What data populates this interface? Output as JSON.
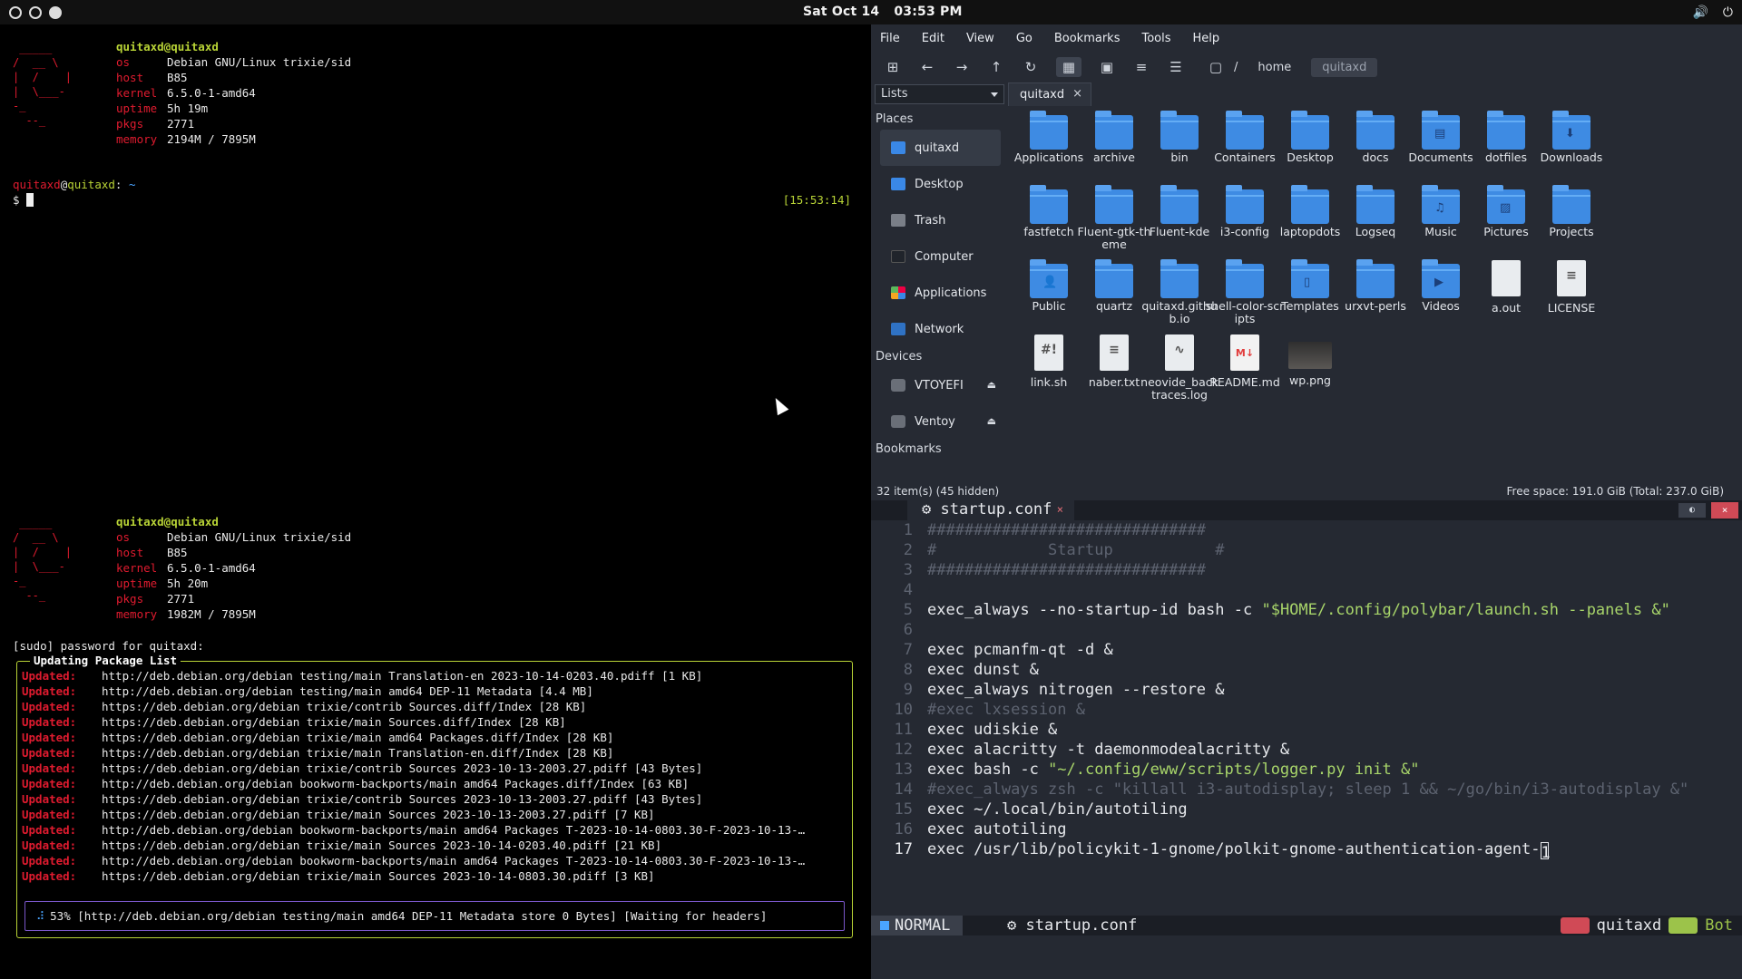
{
  "topbar": {
    "date": "Sat Oct 14",
    "time": "03:53 PM",
    "volume_icon": "volume-icon",
    "power_icon": "power-icon"
  },
  "term1": {
    "fetch": {
      "userhost": "quitaxd@quitaxd",
      "rows": [
        {
          "k": "os",
          "v": "Debian GNU/Linux trixie/sid"
        },
        {
          "k": "host",
          "v": "B85"
        },
        {
          "k": "kernel",
          "v": "6.5.0-1-amd64"
        },
        {
          "k": "uptime",
          "v": "5h 19m"
        },
        {
          "k": "pkgs",
          "v": "2771"
        },
        {
          "k": "memory",
          "v": "2194M / 7895M"
        }
      ]
    },
    "prompt": {
      "user": "quitaxd",
      "host": "quitaxd",
      "dir": "~",
      "time": "[15:53:14]",
      "symbol": "$"
    }
  },
  "term2": {
    "fetch": {
      "userhost": "quitaxd@quitaxd",
      "rows": [
        {
          "k": "os",
          "v": "Debian GNU/Linux trixie/sid"
        },
        {
          "k": "host",
          "v": "B85"
        },
        {
          "k": "kernel",
          "v": "6.5.0-1-amd64"
        },
        {
          "k": "uptime",
          "v": "5h 20m"
        },
        {
          "k": "pkgs",
          "v": "2771"
        },
        {
          "k": "memory",
          "v": "1982M / 7895M"
        }
      ]
    },
    "sudo_prompt": "[sudo] password for quitaxd:",
    "update_title": "Updating Package List",
    "update_label": "Updated:",
    "updates": [
      "http://deb.debian.org/debian testing/main Translation-en 2023-10-14-0203.40.pdiff [1 KB]",
      "http://deb.debian.org/debian testing/main amd64 DEP-11 Metadata [4.4 MB]",
      "https://deb.debian.org/debian trixie/contrib Sources.diff/Index [28 KB]",
      "https://deb.debian.org/debian trixie/main Sources.diff/Index [28 KB]",
      "https://deb.debian.org/debian trixie/main amd64 Packages.diff/Index [28 KB]",
      "https://deb.debian.org/debian trixie/main Translation-en.diff/Index [28 KB]",
      "https://deb.debian.org/debian trixie/contrib Sources 2023-10-13-2003.27.pdiff [43 Bytes]",
      "http://deb.debian.org/debian bookworm-backports/main amd64 Packages.diff/Index [63 KB]",
      "https://deb.debian.org/debian trixie/contrib Sources 2023-10-13-2003.27.pdiff [43 Bytes]",
      "https://deb.debian.org/debian trixie/main Sources 2023-10-13-2003.27.pdiff [7 KB]",
      "http://deb.debian.org/debian bookworm-backports/main amd64 Packages T-2023-10-14-0803.30-F-2023-10-13-…",
      "https://deb.debian.org/debian trixie/main Sources 2023-10-14-0203.40.pdiff [21 KB]",
      "http://deb.debian.org/debian bookworm-backports/main amd64 Packages T-2023-10-14-0803.30-F-2023-10-13-…",
      "https://deb.debian.org/debian trixie/main Sources 2023-10-14-0803.30.pdiff [3 KB]"
    ],
    "progress_text": "53% [http://deb.debian.org/debian testing/main amd64 DEP-11 Metadata store 0 Bytes] [Waiting for headers]",
    "progress_spinner": "⠼"
  },
  "fm": {
    "menu": [
      "File",
      "Edit",
      "View",
      "Go",
      "Bookmarks",
      "Tools",
      "Help"
    ],
    "path_root": "/",
    "path": [
      "home",
      "quitaxd"
    ],
    "side_pane_mode": "Lists",
    "tab": "quitaxd",
    "places_header": "Places",
    "places": [
      "quitaxd",
      "Desktop",
      "Trash",
      "Computer",
      "Applications",
      "Network"
    ],
    "devices_header": "Devices",
    "devices": [
      "VTOYEFI",
      "Ventoy"
    ],
    "bookmarks_header": "Bookmarks",
    "items": [
      {
        "name": "Applications",
        "kind": "folder"
      },
      {
        "name": "archive",
        "kind": "folder"
      },
      {
        "name": "bin",
        "kind": "folder"
      },
      {
        "name": "Containers",
        "kind": "folder"
      },
      {
        "name": "Desktop",
        "kind": "folder"
      },
      {
        "name": "docs",
        "kind": "folder"
      },
      {
        "name": "Documents",
        "kind": "folder"
      },
      {
        "name": "dotfiles",
        "kind": "folder"
      },
      {
        "name": "Downloads",
        "kind": "folder"
      },
      {
        "name": "fastfetch",
        "kind": "folder"
      },
      {
        "name": "Fluent-gtk-theme",
        "kind": "folder"
      },
      {
        "name": "Fluent-kde",
        "kind": "folder"
      },
      {
        "name": "i3-config",
        "kind": "folder"
      },
      {
        "name": "laptopdots",
        "kind": "folder"
      },
      {
        "name": "Logseq",
        "kind": "folder"
      },
      {
        "name": "Music",
        "kind": "folder"
      },
      {
        "name": "Pictures",
        "kind": "folder"
      },
      {
        "name": "Projects",
        "kind": "folder"
      },
      {
        "name": "Public",
        "kind": "folder"
      },
      {
        "name": "quartz",
        "kind": "folder"
      },
      {
        "name": "quitaxd.github.io",
        "kind": "folder"
      },
      {
        "name": "shell-color-scripts",
        "kind": "folder"
      },
      {
        "name": "Templates",
        "kind": "folder"
      },
      {
        "name": "urxvt-perls",
        "kind": "folder"
      },
      {
        "name": "Videos",
        "kind": "folder"
      },
      {
        "name": "a.out",
        "kind": "file"
      },
      {
        "name": "LICENSE",
        "kind": "file"
      },
      {
        "name": "link.sh",
        "kind": "file"
      },
      {
        "name": "naber.txt",
        "kind": "file"
      },
      {
        "name": "neovide_backtraces.log",
        "kind": "file"
      },
      {
        "name": "README.md",
        "kind": "file"
      },
      {
        "name": "wp.png",
        "kind": "image"
      }
    ],
    "status_left": "32 item(s) (45 hidden)",
    "status_right": "Free space: 191.0 GiB (Total: 237.0 GiB)"
  },
  "vim": {
    "tab": "startup.conf",
    "lines": [
      "##############################",
      "#            Startup           #",
      "##############################",
      "",
      "exec_always --no-startup-id bash -c \"$HOME/.config/polybar/launch.sh --panels &\"",
      "",
      "exec pcmanfm-qt -d &",
      "exec dunst &",
      "exec_always nitrogen --restore &",
      "#exec lxsession &",
      "exec udiskie &",
      "exec alacritty -t daemonmodealacritty &",
      "exec bash -c \"~/.config/eww/scripts/logger.py init &\"",
      "#exec_always zsh -c \"killall i3-autodisplay; sleep 1 && ~/go/bin/i3-autodisplay &\"",
      "exec ~/.local/bin/autotiling",
      "exec autotiling",
      "exec /usr/lib/policykit-1-gnome/polkit-gnome-authentication-agent-1"
    ],
    "mode": "NORMAL",
    "filename": "startup.conf",
    "user": "quitaxd",
    "position": "Bot"
  }
}
